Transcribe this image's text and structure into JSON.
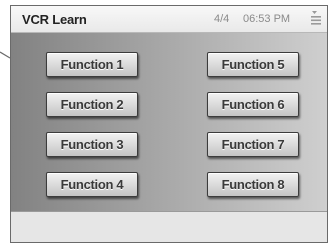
{
  "window": {
    "title": "VCR Learn",
    "page_indicator": "4/4",
    "time": "06:53 PM"
  },
  "icons": {
    "menu": "menu-icon",
    "side_arrow": "arrow-pointer-icon"
  },
  "functions": {
    "left": [
      "Function 1",
      "Function 2",
      "Function 3",
      "Function 4"
    ],
    "right": [
      "Function 5",
      "Function 6",
      "Function 7",
      "Function 8"
    ]
  }
}
